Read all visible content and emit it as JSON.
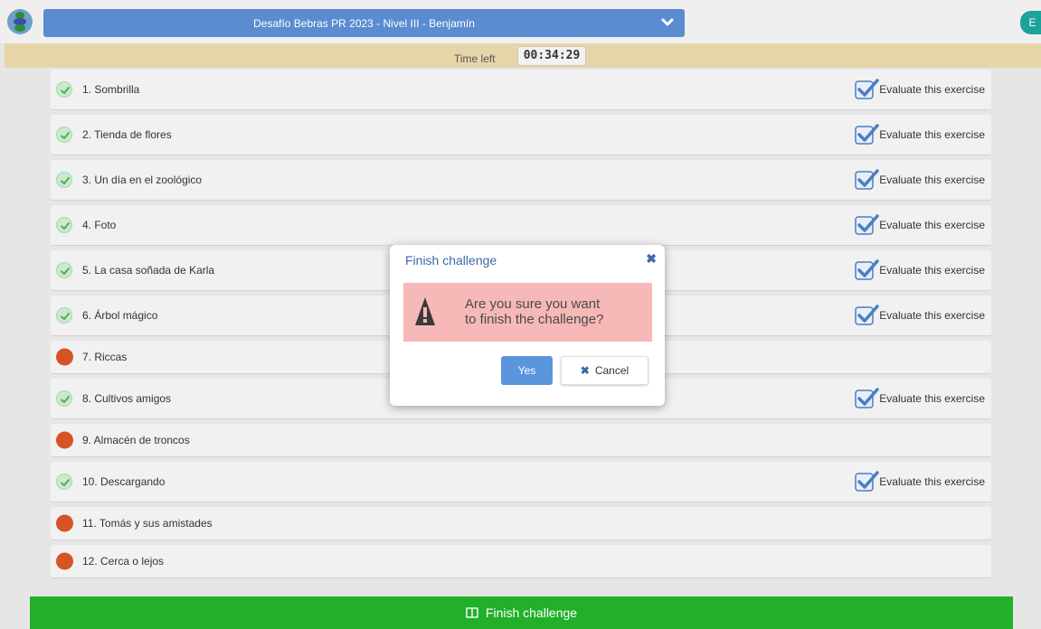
{
  "header": {
    "contest_title": "Desafío Bebras PR 2023 - Nivel III - Benjamín",
    "user_initial": "E",
    "time_label": "Time left",
    "time_value": "00:34:29"
  },
  "evaluate_label": "Evaluate this exercise",
  "tasks": [
    {
      "label": "1. Sombrilla",
      "status": "completed",
      "evaluate": true
    },
    {
      "label": "2. Tienda de flores",
      "status": "completed",
      "evaluate": true
    },
    {
      "label": "3. Un día en el zoológico",
      "status": "completed",
      "evaluate": true
    },
    {
      "label": "4. Foto",
      "status": "completed",
      "evaluate": true
    },
    {
      "label": "5. La casa soñada de Karla",
      "status": "completed",
      "evaluate": true
    },
    {
      "label": "6. Árbol mágico",
      "status": "completed",
      "evaluate": true
    },
    {
      "label": "7. Riccas",
      "status": "pending",
      "evaluate": false
    },
    {
      "label": "8. Cultivos amigos",
      "status": "completed",
      "evaluate": true
    },
    {
      "label": "9. Almacén de troncos",
      "status": "pending",
      "evaluate": false
    },
    {
      "label": "10. Descargando",
      "status": "completed",
      "evaluate": true
    },
    {
      "label": "11. Tomás y sus amistades",
      "status": "pending",
      "evaluate": false
    },
    {
      "label": "12. Cerca o lejos",
      "status": "pending",
      "evaluate": false
    }
  ],
  "finish_button": "Finish challenge",
  "modal": {
    "title": "Finish challenge",
    "message_line1": "Are you sure you want",
    "message_line2": "to finish the challenge?",
    "yes": "Yes",
    "cancel": "Cancel"
  },
  "colors": {
    "header_select": "#5b8bd0",
    "timebar": "#e6d5a8",
    "completed": "#cbe9cf",
    "pending": "#d65325",
    "finish": "#22b02a",
    "alert": "#f7b8b8"
  }
}
